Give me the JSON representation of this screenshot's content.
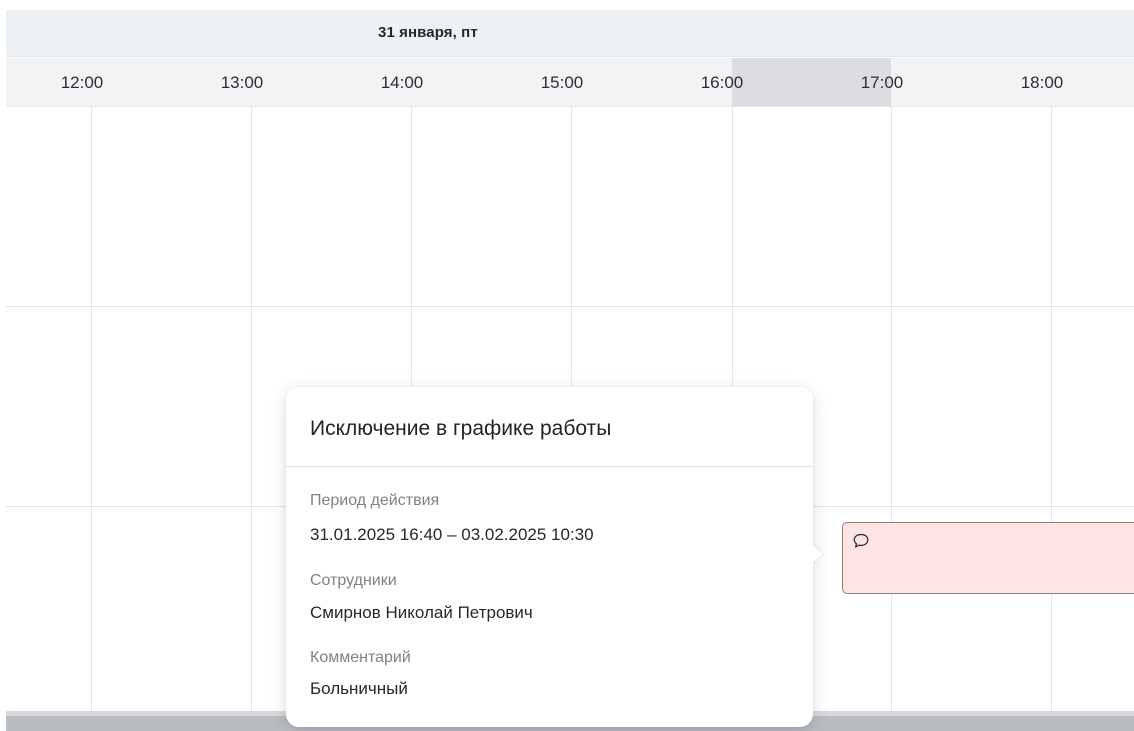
{
  "calendar": {
    "date_label": "31 января, пт",
    "times": [
      "12:00",
      "13:00",
      "14:00",
      "15:00",
      "16:00",
      "17:00",
      "18:00"
    ]
  },
  "event": {
    "icon": "comment-icon",
    "colors": {
      "fill": "#fde4e5",
      "border": "#8e8083"
    }
  },
  "popover": {
    "title": "Исключение в графике работы",
    "period_label": "Период действия",
    "period_value": "31.01.2025 16:40 – 03.02.2025 10:30",
    "employees_label": "Сотрудники",
    "employees_value": "Смирнов Николай Петрович",
    "comment_label": "Комментарий",
    "comment_value": "Больничный"
  }
}
